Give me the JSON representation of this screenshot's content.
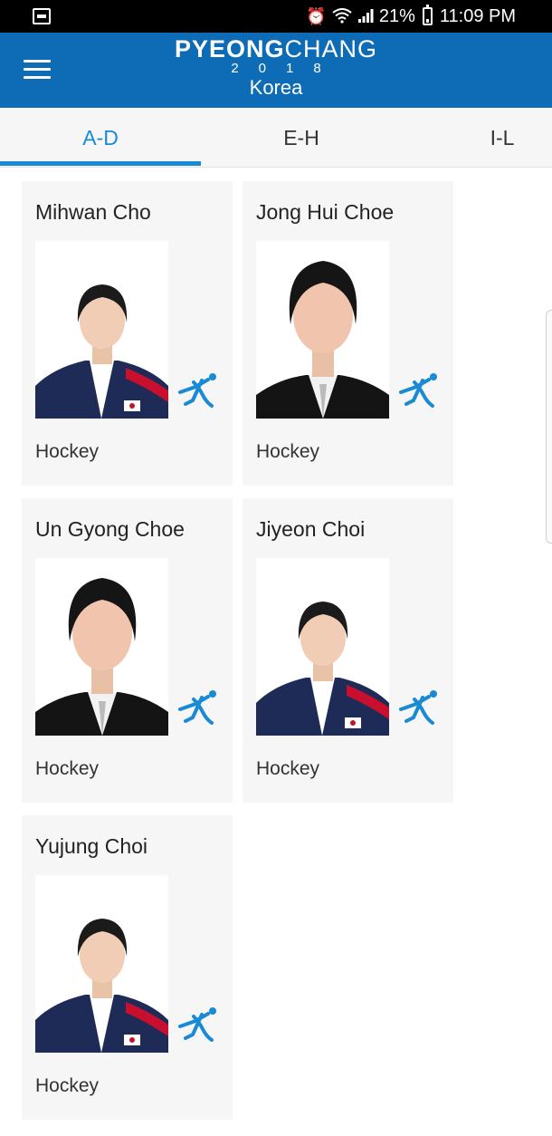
{
  "status_bar": {
    "battery": "21%",
    "time": "11:09 PM"
  },
  "header": {
    "brand_part1": "PYEONG",
    "brand_part2": "CHANG",
    "brand_year": "2018",
    "subtitle": "Korea"
  },
  "tabs": [
    {
      "label": "A-D",
      "selected": true
    },
    {
      "label": "E-H",
      "selected": false
    },
    {
      "label": "I-L",
      "selected": false
    }
  ],
  "athletes": [
    {
      "name": "Mihwan Cho",
      "sport": "Hockey",
      "jacket": "team"
    },
    {
      "name": "Jong Hui Choe",
      "sport": "Hockey",
      "jacket": "suit"
    },
    {
      "name": "Un Gyong Choe",
      "sport": "Hockey",
      "jacket": "suit"
    },
    {
      "name": "Jiyeon Choi",
      "sport": "Hockey",
      "jacket": "team"
    },
    {
      "name": "Yujung Choi",
      "sport": "Hockey",
      "jacket": "team"
    }
  ],
  "colors": {
    "app_bar": "#0d6cb5",
    "accent": "#1a8ad4",
    "card_bg": "#f6f6f6"
  },
  "icons": {
    "sport_icon": "hockey-player-icon"
  }
}
